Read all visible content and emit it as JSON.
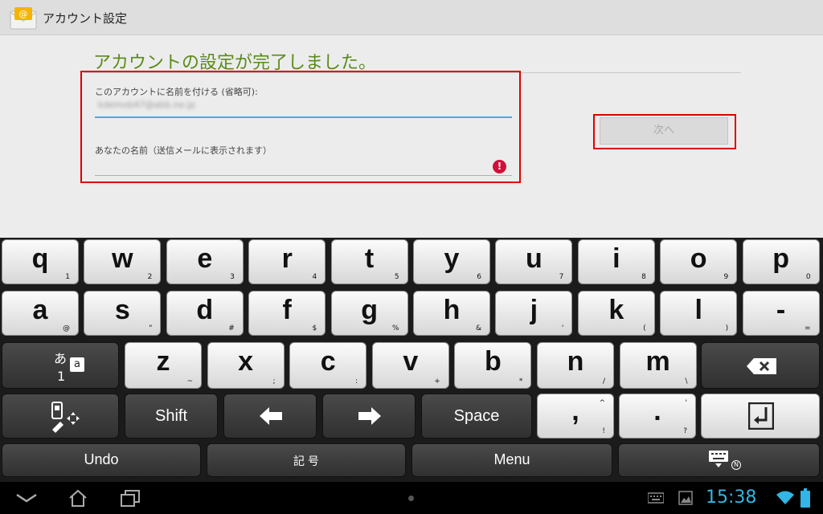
{
  "titlebar": {
    "title": "アカウント設定"
  },
  "main": {
    "heading": "アカウントの設定が完了しました。",
    "account_name": {
      "label": "このアカウントに名前を付ける (省略可):",
      "value": "kdemob47@abb.ne.jp"
    },
    "your_name": {
      "label": "あなたの名前（送信メールに表示されます）",
      "value": ""
    },
    "error_icon": "!",
    "next_label": "次へ"
  },
  "keyboard": {
    "row1": [
      {
        "main": "q",
        "sub": "1"
      },
      {
        "main": "w",
        "sub": "2"
      },
      {
        "main": "e",
        "sub": "3"
      },
      {
        "main": "r",
        "sub": "4"
      },
      {
        "main": "t",
        "sub": "5"
      },
      {
        "main": "y",
        "sub": "6"
      },
      {
        "main": "u",
        "sub": "7"
      },
      {
        "main": "i",
        "sub": "8"
      },
      {
        "main": "o",
        "sub": "9"
      },
      {
        "main": "p",
        "sub": "0"
      }
    ],
    "row2": [
      {
        "main": "a",
        "sub": "@"
      },
      {
        "main": "s",
        "sub": "\""
      },
      {
        "main": "d",
        "sub": "#"
      },
      {
        "main": "f",
        "sub": "$"
      },
      {
        "main": "g",
        "sub": "%"
      },
      {
        "main": "h",
        "sub": "&"
      },
      {
        "main": "j",
        "sub": "'"
      },
      {
        "main": "k",
        "sub": "("
      },
      {
        "main": "l",
        "sub": ")"
      },
      {
        "main": "-",
        "sub": "="
      }
    ],
    "row3": [
      {
        "main": "z",
        "sub": "~"
      },
      {
        "main": "x",
        "sub": ";"
      },
      {
        "main": "c",
        "sub": ":"
      },
      {
        "main": "v",
        "sub": "+"
      },
      {
        "main": "b",
        "sub": "*"
      },
      {
        "main": "n",
        "sub": "/"
      },
      {
        "main": "m",
        "sub": "\\"
      }
    ],
    "mode_key": {
      "top": "あ",
      "bottom": "1",
      "box": "a"
    },
    "shift": "Shift",
    "space": "Space",
    "comma": {
      "main": ",",
      "top": "^",
      "bottom": "!"
    },
    "period": {
      "main": ".",
      "top": "'",
      "bottom": "?"
    },
    "undo": "Undo",
    "symbols": "記 号",
    "menu": "Menu",
    "ime_badge": "N"
  },
  "navbar": {
    "time": "15:38"
  }
}
